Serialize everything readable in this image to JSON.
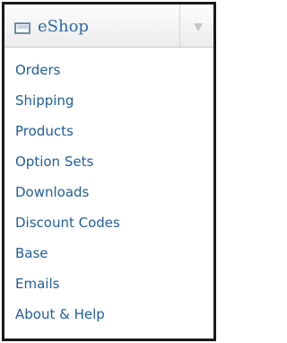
{
  "panel": {
    "title": "eShop",
    "icon": "window-icon",
    "toggle_icon": "chevron-down-icon",
    "link_color": "#205e9e"
  },
  "menu": {
    "items": [
      {
        "label": "Orders"
      },
      {
        "label": "Shipping"
      },
      {
        "label": "Products"
      },
      {
        "label": "Option Sets"
      },
      {
        "label": "Downloads"
      },
      {
        "label": "Discount Codes"
      },
      {
        "label": "Base"
      },
      {
        "label": "Emails"
      },
      {
        "label": "About & Help"
      }
    ]
  }
}
